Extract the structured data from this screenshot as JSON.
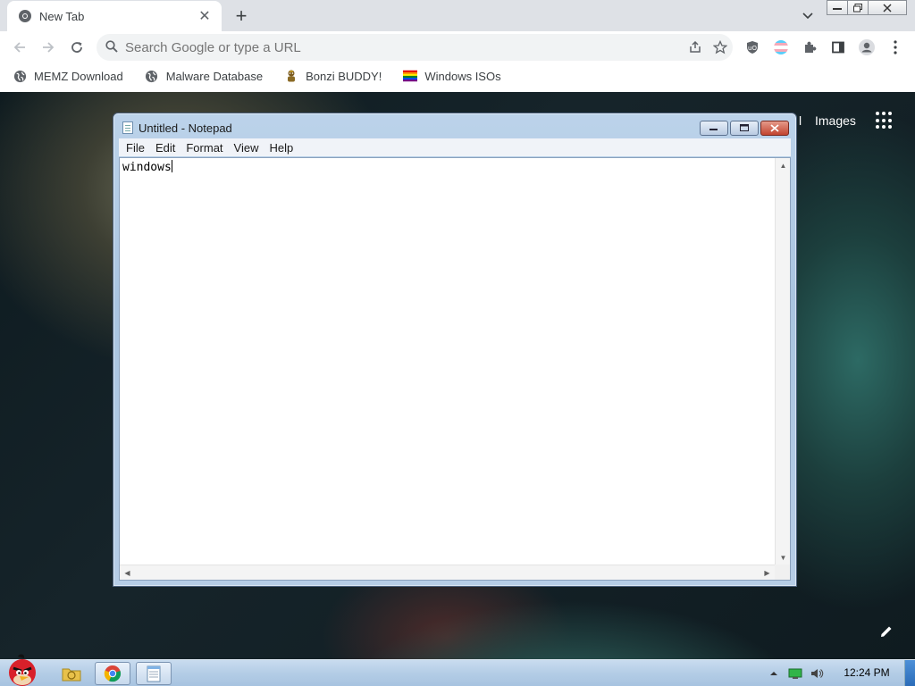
{
  "browser": {
    "tab": {
      "title": "New Tab",
      "close_glyph": "✕"
    },
    "new_tab_glyph": "+",
    "omnibox": {
      "placeholder": "Search Google or type a URL",
      "value": ""
    },
    "bookmarks": [
      {
        "label": "MEMZ Download",
        "icon": "globe-icon"
      },
      {
        "label": "Malware Database",
        "icon": "globe-icon"
      },
      {
        "label": "Bonzi BUDDY!",
        "icon": "bonzi-icon"
      },
      {
        "label": "Windows ISOs",
        "icon": "rainbow-flag-icon"
      }
    ]
  },
  "newtab_page": {
    "gmail_tail": "l",
    "images_link": "Images"
  },
  "notepad": {
    "title": "Untitled - Notepad",
    "menus": [
      "File",
      "Edit",
      "Format",
      "View",
      "Help"
    ],
    "content": "windows"
  },
  "taskbar": {
    "clock": "12:24 PM"
  },
  "colors": {
    "taskbar": "#b4cde6",
    "notepad_frame": "#a9c4e0",
    "chrome_tabstrip": "#dee1e6",
    "notepad_close": "#c24430"
  }
}
